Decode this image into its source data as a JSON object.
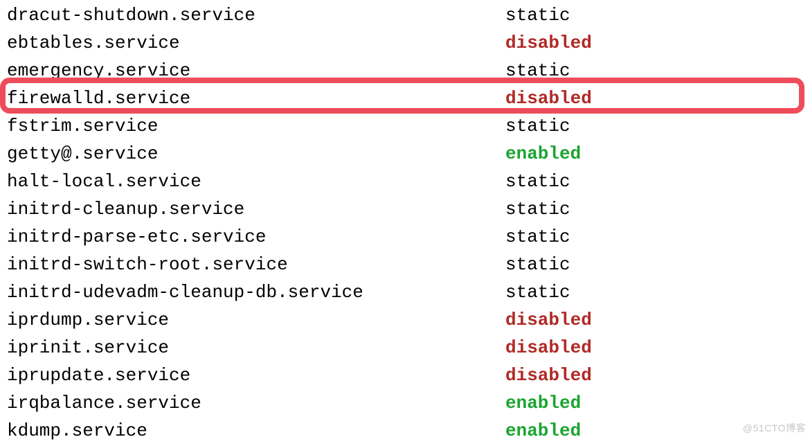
{
  "services": [
    {
      "name": "dracut-shutdown.service",
      "status": "static",
      "style": "static"
    },
    {
      "name": "ebtables.service",
      "status": "disabled",
      "style": "disabled"
    },
    {
      "name": "emergency.service",
      "status": "static",
      "style": "static"
    },
    {
      "name": "firewalld.service",
      "status": "disabled",
      "style": "disabled"
    },
    {
      "name": "fstrim.service",
      "status": "static",
      "style": "static"
    },
    {
      "name": "getty@.service",
      "status": "enabled",
      "style": "enabled"
    },
    {
      "name": "halt-local.service",
      "status": "static",
      "style": "static"
    },
    {
      "name": "initrd-cleanup.service",
      "status": "static",
      "style": "static"
    },
    {
      "name": "initrd-parse-etc.service",
      "status": "static",
      "style": "static"
    },
    {
      "name": "initrd-switch-root.service",
      "status": "static",
      "style": "static"
    },
    {
      "name": "initrd-udevadm-cleanup-db.service",
      "status": "static",
      "style": "static"
    },
    {
      "name": "iprdump.service",
      "status": "disabled",
      "style": "disabled"
    },
    {
      "name": "iprinit.service",
      "status": "disabled",
      "style": "disabled"
    },
    {
      "name": "iprupdate.service",
      "status": "disabled",
      "style": "disabled"
    },
    {
      "name": "irqbalance.service",
      "status": "enabled",
      "style": "enabled"
    },
    {
      "name": "kdump.service",
      "status": "enabled",
      "style": "enabled"
    }
  ],
  "highlight_index": 3,
  "watermark": "@51CTO博客"
}
